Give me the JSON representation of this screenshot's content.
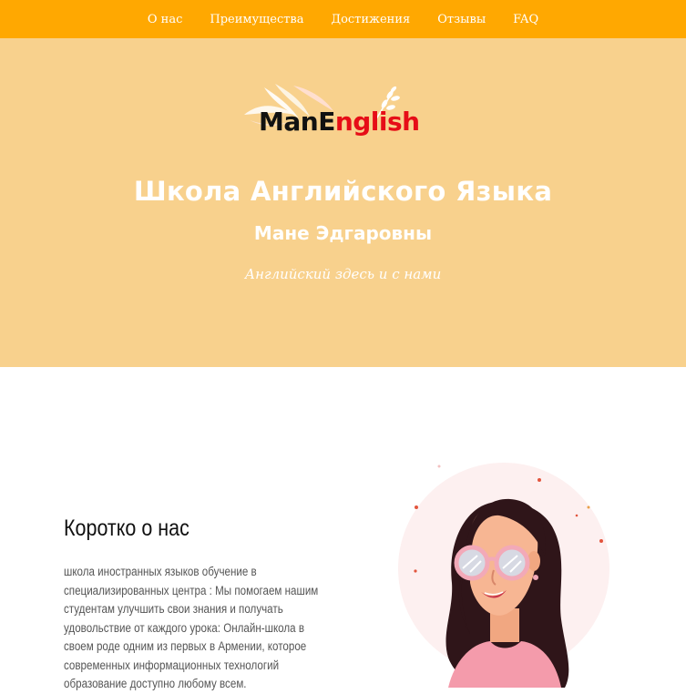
{
  "nav": {
    "items": [
      {
        "label": "О нас"
      },
      {
        "label": "Преимущества"
      },
      {
        "label": "Достижения"
      },
      {
        "label": "Отзывы"
      },
      {
        "label": "FAQ"
      }
    ]
  },
  "hero": {
    "logo": {
      "part1": "ManE",
      "part2": "nglish"
    },
    "title": "Школа Английского Языка",
    "subtitle": "Мане Эдгаровны",
    "tagline": "Английский здесь и с нами"
  },
  "about": {
    "title": "Коротко о нас",
    "text": "школа иностранных языков обучение в специализированных центра : Мы помогаем нашим студентам улучшить свои знания и получать удовольствие от каждого урока: Онлайн-школа в своем роде одним из первых в Армении, которое современных информационных технологий образование доступно любому всем."
  },
  "colors": {
    "nav_bg": "#ffa801",
    "hero_bg": "#f8d18d",
    "logo_red": "#e60d17",
    "illustration_circle": "#fdf0f0"
  }
}
